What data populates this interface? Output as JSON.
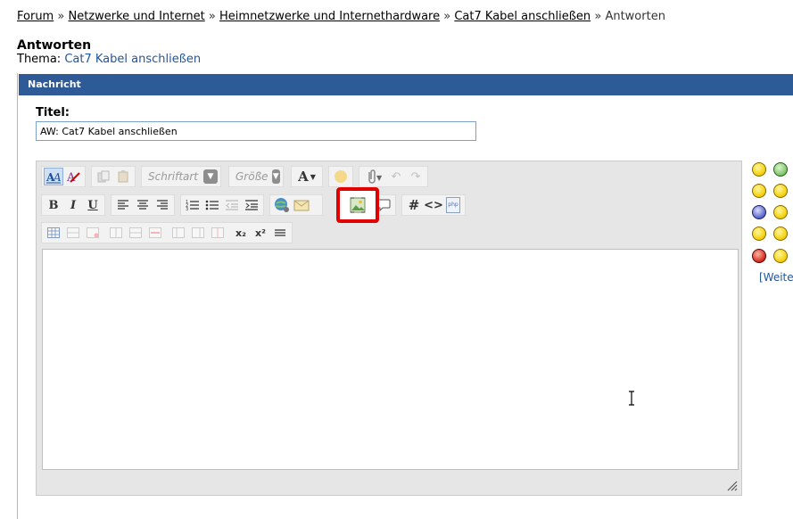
{
  "breadcrumb": {
    "items": [
      "Forum",
      "Netzwerke und Internet",
      "Heimnetzwerke und Internethardware",
      "Cat7 Kabel anschließen"
    ],
    "current": "Antworten",
    "separator": "»"
  },
  "page": {
    "title": "Antworten",
    "thema_label": "Thema:",
    "thema_link": "Cat7 Kabel anschließen"
  },
  "panel": {
    "header": "Nachricht"
  },
  "form": {
    "title_label": "Titel:",
    "title_value": "AW: Cat7 Kabel anschließen"
  },
  "toolbar": {
    "font_placeholder": "Schriftart",
    "size_placeholder": "Größe",
    "bold": "B",
    "italic": "I",
    "underline": "U",
    "font_color": "A",
    "hash": "#",
    "code": "<>",
    "php": "php",
    "subscript": "x₂",
    "superscript": "x²"
  },
  "smilies": {
    "more_link": "[Weiter"
  },
  "colors": {
    "panel_header": "#2e5a97",
    "link": "#22559c",
    "highlight": "#e00000"
  }
}
